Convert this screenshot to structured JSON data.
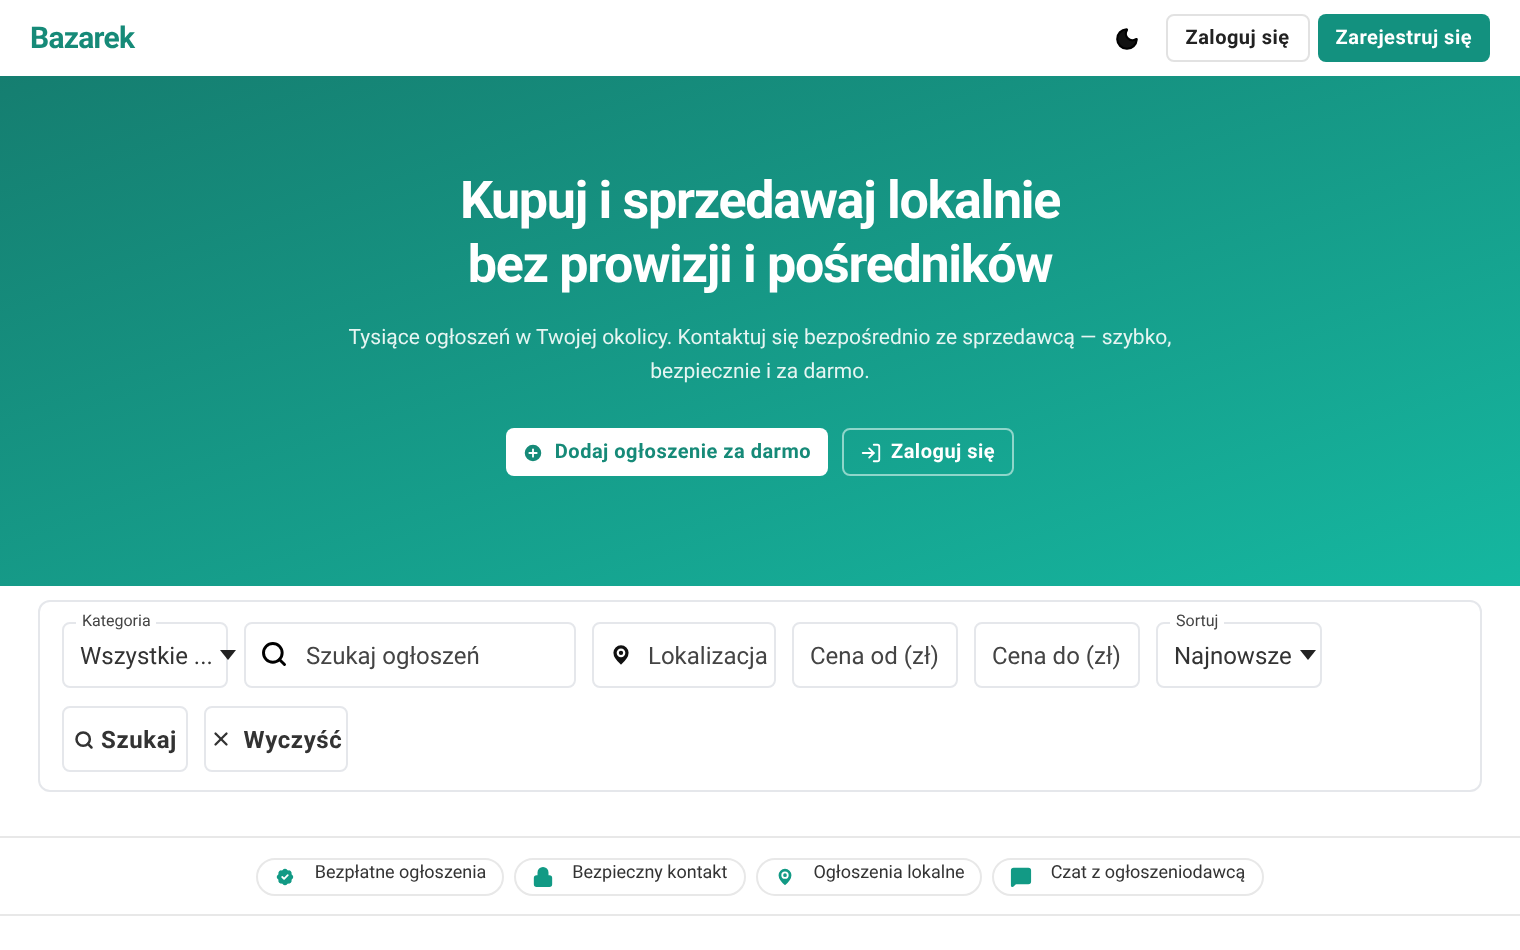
{
  "header": {
    "logo": "Bazarek",
    "login": "Zaloguj się",
    "register": "Zarejestruj się"
  },
  "hero": {
    "title_lines": [
      "Kupuj i sprzedawaj lokalnie",
      "bez prowizji i pośredników"
    ],
    "subtitle": "Tysiące ogłoszeń w Twojej okolicy. Kontaktuj się bezpośrednio ze sprzedawcą — szybko, bezpiecznie i za darmo.",
    "primary_button": "Dodaj ogłoszenie za darmo",
    "secondary_button": "Zaloguj się"
  },
  "filters": [
    {
      "kind": "select",
      "label": "Kategoria",
      "value": "Wszystkie ..."
    },
    {
      "kind": "search",
      "placeholder": "Szukaj ogłoszeń"
    },
    {
      "kind": "location",
      "placeholder": "Lokalizacja"
    },
    {
      "kind": "text",
      "placeholder": "Cena od (zł)"
    },
    {
      "kind": "text",
      "placeholder": "Cena do (zł)"
    },
    {
      "kind": "select",
      "label": "Sortuj",
      "value": "Najnowsze"
    },
    {
      "kind": "search_button",
      "text": "Szukaj"
    },
    {
      "kind": "clear_button",
      "text": "Wyczyść"
    }
  ],
  "features": [
    {
      "kind": "check",
      "text": "Bezpłatne ogłoszenia"
    },
    {
      "kind": "lock",
      "text": "Bezpieczny kontakt"
    },
    {
      "kind": "pin",
      "text": "Ogłoszenia lokalne"
    },
    {
      "kind": "chat",
      "text": "Czat z ogłoszeniodawcą"
    }
  ]
}
